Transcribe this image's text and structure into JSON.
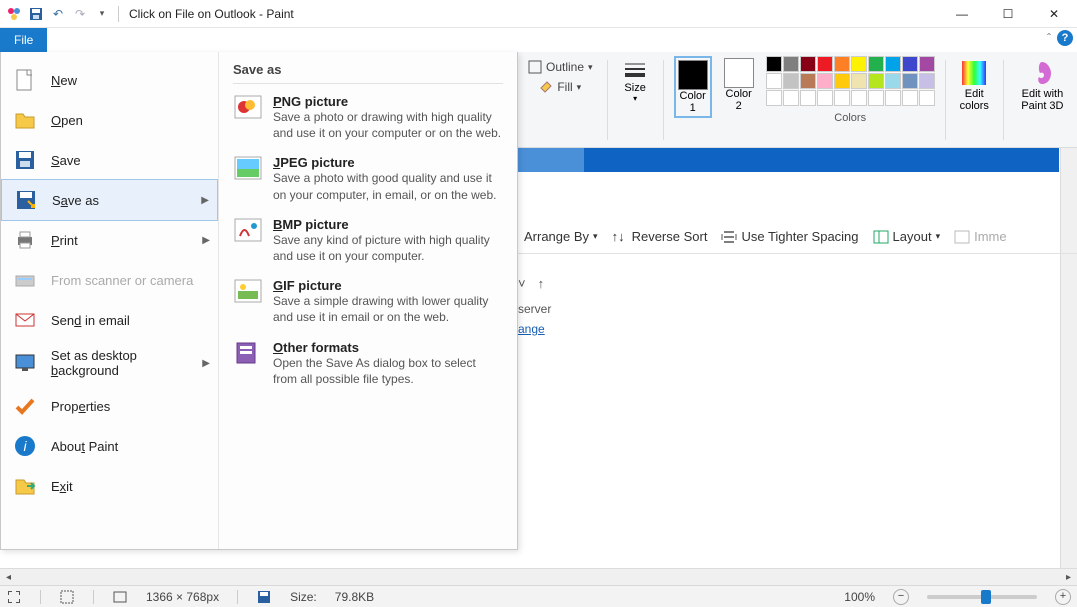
{
  "titlebar": {
    "title": "Click on File on Outlook - Paint"
  },
  "file_tab": "File",
  "file_menu": {
    "items": [
      {
        "label": "New",
        "accel": "N",
        "icon": "new-doc"
      },
      {
        "label": "Open",
        "accel": "O",
        "icon": "open-folder"
      },
      {
        "label": "Save",
        "accel": "S",
        "icon": "save-disk"
      },
      {
        "label": "Save as",
        "accel": "a",
        "icon": "save-as",
        "submenu": true,
        "selected": true
      },
      {
        "label": "Print",
        "accel": "P",
        "icon": "printer",
        "submenu": true
      },
      {
        "label": "From scanner or camera",
        "icon": "scanner",
        "disabled": true
      },
      {
        "label": "Send in email",
        "accel": "d",
        "icon": "mail"
      },
      {
        "label": "Set as desktop background",
        "accel": "b",
        "icon": "desktop-bg",
        "submenu": true
      },
      {
        "label": "Properties",
        "accel": "e",
        "icon": "properties-check"
      },
      {
        "label": "About Paint",
        "accel": "t",
        "icon": "info"
      },
      {
        "label": "Exit",
        "accel": "x",
        "icon": "exit"
      }
    ],
    "saveas_panel": {
      "title": "Save as",
      "options": [
        {
          "title": "PNG picture",
          "accel": "P",
          "desc": "Save a photo or drawing with high quality and use it on your computer or on the web."
        },
        {
          "title": "JPEG picture",
          "accel": "J",
          "desc": "Save a photo with good quality and use it on your computer, in email, or on the web."
        },
        {
          "title": "BMP picture",
          "accel": "B",
          "desc": "Save any kind of picture with high quality and use it on your computer."
        },
        {
          "title": "GIF picture",
          "accel": "G",
          "desc": "Save a simple drawing with lower quality and use it in email or on the web."
        },
        {
          "title": "Other formats",
          "accel": "O",
          "desc": "Open the Save As dialog box to select from all possible file types."
        }
      ]
    }
  },
  "ribbon": {
    "outline": "Outline",
    "fill": "Fill",
    "size": "Size",
    "color1": "Color 1",
    "color2": "Color 2",
    "edit_colors": "Edit colors",
    "edit_3d": "Edit with Paint 3D",
    "group_label": "Colors",
    "palette_row1": [
      "#000000",
      "#7f7f7f",
      "#880015",
      "#ed1c24",
      "#ff7f27",
      "#fff200",
      "#22b14c",
      "#00a2e8",
      "#3f48cc",
      "#a349a4"
    ],
    "palette_row2": [
      "#ffffff",
      "#c3c3c3",
      "#b97a57",
      "#ffaec9",
      "#ffc90e",
      "#efe4b0",
      "#b5e61d",
      "#99d9ea",
      "#7092be",
      "#c8bfe7"
    ],
    "palette_row3": [
      "#ffffff",
      "#ffffff",
      "#ffffff",
      "#ffffff",
      "#ffffff",
      "#ffffff",
      "#ffffff",
      "#ffffff",
      "#ffffff",
      "#ffffff"
    ]
  },
  "sectoolbar": {
    "arrange_by": "Arrange By",
    "reverse_sort": "Reverse Sort",
    "tighter": "Use Tighter Spacing",
    "layout": "Layout",
    "imme": "Imme"
  },
  "server_text": {
    "line": "server",
    "link": "ange"
  },
  "statusbar": {
    "dimensions": "1366 × 768px",
    "size_label": "Size:",
    "size_value": "79.8KB",
    "zoom": "100%"
  }
}
